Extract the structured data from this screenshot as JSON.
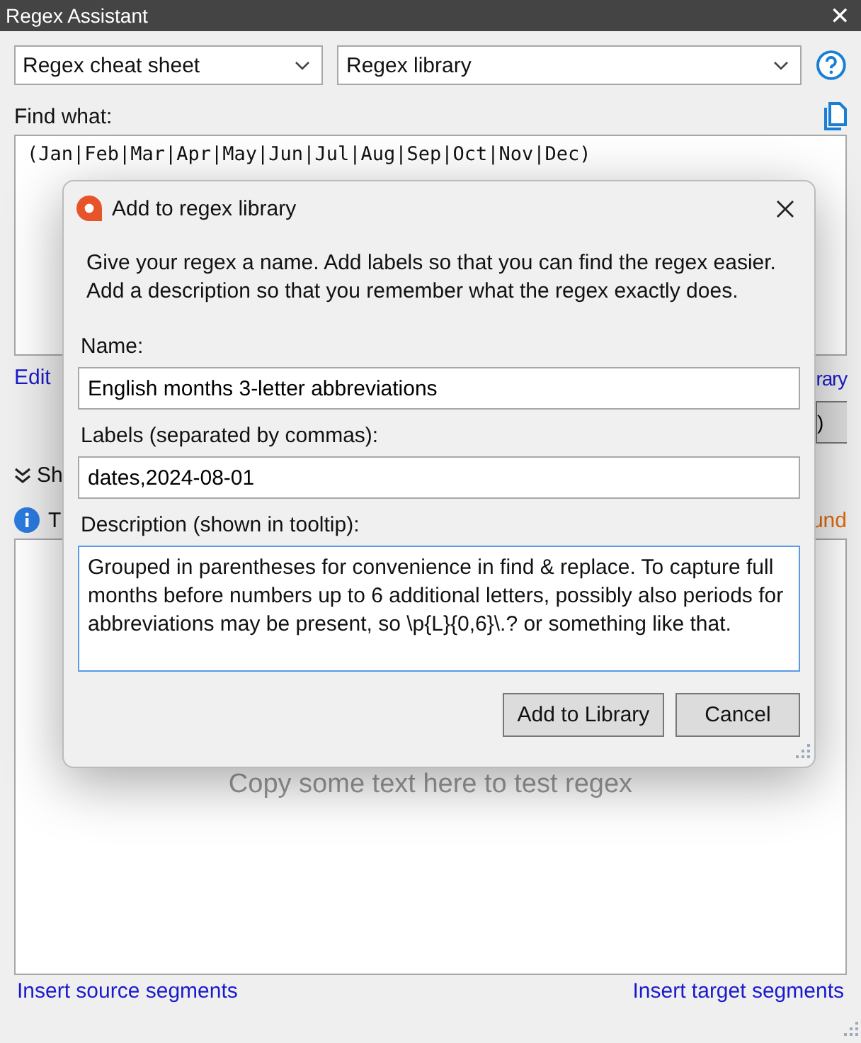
{
  "window": {
    "title": "Regex Assistant",
    "close": "✕"
  },
  "dropdowns": [
    {
      "value": "Regex cheat sheet"
    },
    {
      "value": "Regex library"
    }
  ],
  "find": {
    "label": "Find what:",
    "value": "(Jan|Feb|Mar|Apr|May|Jun|Jul|Aug|Sep|Oct|Nov|Dec)"
  },
  "links_row": {
    "left": "Edit",
    "right": "rary"
  },
  "button_fragment": ")",
  "show_row": {
    "label": "Sh"
  },
  "test_row": {
    "label": "T",
    "right": "und"
  },
  "test_box": {
    "placeholder": "Copy some text here to test regex"
  },
  "bottom_links": [
    "Insert source segments",
    "Insert target segments"
  ],
  "dialog": {
    "title": "Add to regex library",
    "intro": "Give your regex a name. Add labels so that you can find the regex easier. Add a description so that you remember what the regex exactly does.",
    "fields": [
      {
        "kind": "line",
        "label": "Name:",
        "value": "English months 3-letter abbreviations",
        "focused": false
      },
      {
        "kind": "line",
        "label": "Labels (separated by commas):",
        "value": "dates,2024-08-01",
        "focused": false
      },
      {
        "kind": "area",
        "label": "Description (shown in tooltip):",
        "value": "Grouped in parentheses for convenience in find & replace. To capture full months before numbers up to 6 additional letters, possibly also periods for abbreviations may be present, so \\p{L}{0,6}\\.? or something like that.",
        "focused": true
      }
    ],
    "buttons": [
      "Add to Library",
      "Cancel"
    ]
  }
}
